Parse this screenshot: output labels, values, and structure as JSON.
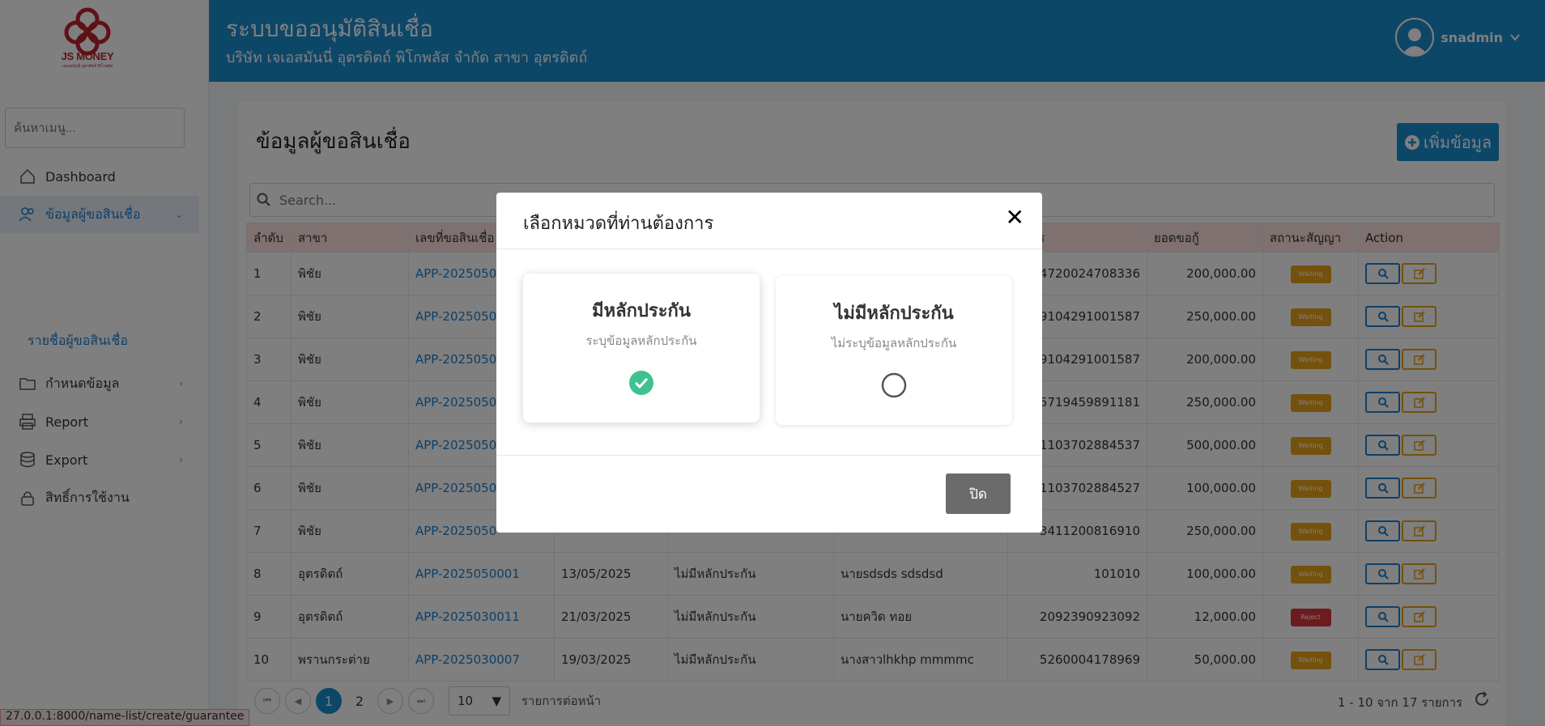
{
  "header": {
    "logo_text": "JS MONEY",
    "logo_sub": "เจเอสมันนี่ อุตรดิตถ์ พิโกพลัส",
    "title": "ระบบขออนุมัติสินเชื่อ",
    "subtitle": "บริษัท เจเอสมันนี่ อุตรดิตถ์ พิโกพลัส จำกัด สาขา อุตรดิตถ์",
    "username": "snadmin"
  },
  "sidebar": {
    "search_placeholder": "ค้นหาเมนู...",
    "items": [
      {
        "label": "Dashboard"
      },
      {
        "label": "ข้อมูลผู้ขอสินเชื่อ"
      },
      {
        "label": "กำหนดข้อมูล"
      },
      {
        "label": "Report"
      },
      {
        "label": "Export"
      },
      {
        "label": "สิทธิ์การใช้งาน"
      }
    ],
    "submenu": "รายชื่อผู้ขอสินเชื่อ"
  },
  "main": {
    "title": "ข้อมูลผู้ขอสินเชื่อ",
    "add_button": "เพิ่มข้อมูล",
    "search_placeholder": "Search...",
    "columns": [
      "ลำดับ",
      "สาขา",
      "เลขที่ขอสินเชื่อ",
      "",
      "",
      "",
      "ที่บัตร",
      "ยอดขอกู้",
      "สถานะสัญญา",
      "Action"
    ],
    "rows": [
      {
        "no": "1",
        "branch": "พิชัย",
        "app": "APP-2025050",
        "date": "",
        "type": "",
        "name": "",
        "card": "4720024708336",
        "amount": "200,000.00",
        "status": "Waiting"
      },
      {
        "no": "2",
        "branch": "พิชัย",
        "app": "APP-2025050",
        "date": "",
        "type": "",
        "name": "",
        "card": "9104291001587",
        "amount": "250,000.00",
        "status": "Waiting"
      },
      {
        "no": "3",
        "branch": "พิชัย",
        "app": "APP-2025050",
        "date": "",
        "type": "",
        "name": "",
        "card": "9104291001587",
        "amount": "200,000.00",
        "status": "Waiting"
      },
      {
        "no": "4",
        "branch": "พิชัย",
        "app": "APP-2025050",
        "date": "",
        "type": "",
        "name": "",
        "card": "5719459891181",
        "amount": "250,000.00",
        "status": "Waiting"
      },
      {
        "no": "5",
        "branch": "พิชัย",
        "app": "APP-2025050",
        "date": "",
        "type": "",
        "name": "",
        "card": "1103702884537",
        "amount": "500,000.00",
        "status": "Waiting"
      },
      {
        "no": "6",
        "branch": "พิชัย",
        "app": "APP-2025050",
        "date": "",
        "type": "",
        "name": "",
        "card": "1103702884527",
        "amount": "100,000.00",
        "status": "Waiting"
      },
      {
        "no": "7",
        "branch": "พิชัย",
        "app": "APP-2025050",
        "date": "",
        "type": "",
        "name": "",
        "card": "3411200816910",
        "amount": "250,000.00",
        "status": "Waiting"
      },
      {
        "no": "8",
        "branch": "อุตรดิตถ์",
        "app": "APP-2025050001",
        "date": "13/05/2025",
        "type": "ไม่มีหลักประกัน",
        "name": "นายsdsds sdsdsd",
        "card": "101010",
        "amount": "100,000.00",
        "status": "Waiting"
      },
      {
        "no": "9",
        "branch": "อุตรดิตถ์",
        "app": "APP-2025030011",
        "date": "21/03/2025",
        "type": "ไม่มีหลักประกัน",
        "name": "นายควิด ทอย",
        "card": "2092390923092",
        "amount": "12,000.00",
        "status": "Reject"
      },
      {
        "no": "10",
        "branch": "พรานกระต่าย",
        "app": "APP-2025030007",
        "date": "19/03/2025",
        "type": "ไม่มีหลักประกัน",
        "name": "นางสาวlhkhp mmmmc",
        "card": "5260004178969",
        "amount": "50,000.00",
        "status": "Waiting"
      }
    ],
    "pager": {
      "pages": [
        "1",
        "2"
      ],
      "current": "1",
      "per_page": "10",
      "per_page_label": "รายการต่อหน้า",
      "info": "1 - 10 จาก 17 รายการ"
    }
  },
  "modal": {
    "title": "เลือกหมวดที่ท่านต้องการ",
    "options": [
      {
        "title": "มีหลักประกัน",
        "sub": "ระบุข้อมูลหลักประกัน",
        "selected": true
      },
      {
        "title": "ไม่มีหลักประกัน",
        "sub": "ไม่ระบุข้อมูลหลักประกัน",
        "selected": false
      }
    ],
    "close_button": "ปิด"
  },
  "status_bar": "27.0.0.1:8000/name-list/create/guarantee",
  "colors": {
    "primary": "#1a8fd1",
    "waiting": "#e8a318",
    "reject": "#d9363e",
    "check": "#3ec28f"
  }
}
